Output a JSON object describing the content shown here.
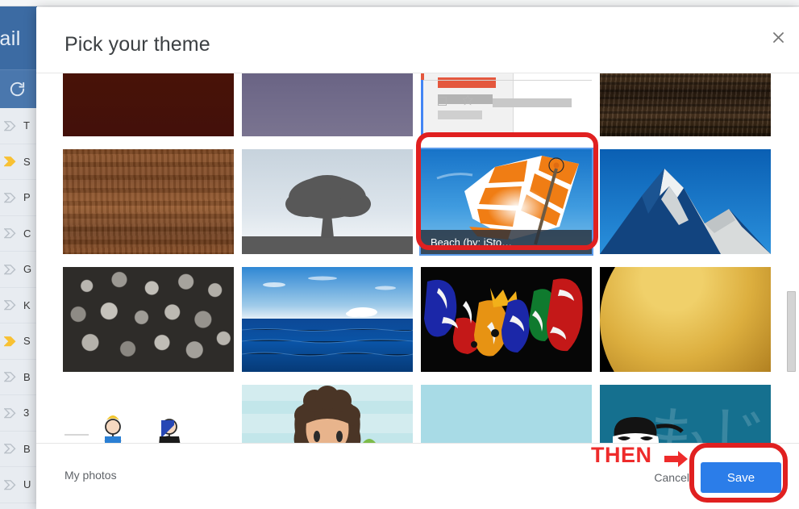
{
  "background_app": {
    "name": "Gmail",
    "logo_text": "mail",
    "refresh_icon": "refresh-icon",
    "mail_rows": [
      {
        "marker": "chevron-outline",
        "subject": "T"
      },
      {
        "marker": "chevron-filled",
        "subject": "S"
      },
      {
        "marker": "chevron-outline",
        "subject": "P"
      },
      {
        "marker": "chevron-outline",
        "subject": "C"
      },
      {
        "marker": "chevron-outline",
        "subject": "G"
      },
      {
        "marker": "chevron-outline",
        "subject": "K"
      },
      {
        "marker": "chevron-filled",
        "subject": "S"
      },
      {
        "marker": "chevron-outline",
        "subject": "B"
      },
      {
        "marker": "chevron-outline",
        "subject": "3"
      },
      {
        "marker": "chevron-outline",
        "subject": "B"
      },
      {
        "marker": "chevron-outline",
        "subject": "U"
      }
    ]
  },
  "dialog": {
    "title": "Pick your theme",
    "close_icon": "close-icon",
    "themes": [
      {
        "id": "maroon",
        "art": "art-maroon",
        "name": "Dark maroon",
        "caption": "",
        "selected": false
      },
      {
        "id": "purple",
        "art": "art-purple",
        "name": "Purple",
        "caption": "",
        "selected": false
      },
      {
        "id": "default",
        "art": "art-default",
        "name": "Default",
        "caption": "",
        "selected": false
      },
      {
        "id": "darkwood",
        "art": "art-darkwood",
        "name": "Dark wood",
        "caption": "",
        "selected": false
      },
      {
        "id": "wood",
        "art": "art-wood",
        "name": "Wood",
        "caption": "",
        "selected": false
      },
      {
        "id": "tree",
        "art": "art-tree",
        "name": "Tree",
        "caption": "",
        "selected": false
      },
      {
        "id": "beach",
        "art": "art-beach",
        "name": "Beach",
        "caption": "Beach (by: iSto…",
        "selected": true
      },
      {
        "id": "mountain",
        "art": "art-mountain",
        "name": "Mountain",
        "caption": "",
        "selected": false
      },
      {
        "id": "stones",
        "art": "art-stones",
        "name": "Stones",
        "caption": "",
        "selected": false
      },
      {
        "id": "ocean",
        "art": "art-ocean",
        "name": "Ocean",
        "caption": "",
        "selected": false
      },
      {
        "id": "graffiti",
        "art": "art-graffiti",
        "name": "Graffiti",
        "caption": "",
        "selected": false
      },
      {
        "id": "planet",
        "art": "art-planet",
        "name": "Planet",
        "caption": "",
        "selected": false
      },
      {
        "id": "cartoon1",
        "art": "art-cartoon1",
        "name": "Stick figures",
        "caption": "",
        "selected": false
      },
      {
        "id": "cartoon2",
        "art": "art-cartoon2",
        "name": "Girl cartoon",
        "caption": "",
        "selected": false
      },
      {
        "id": "cyan",
        "art": "art-cyan",
        "name": "Light blue",
        "caption": "",
        "selected": false
      },
      {
        "id": "ninja",
        "art": "art-ninja",
        "name": "Ninja",
        "caption": "",
        "selected": false
      }
    ],
    "footer": {
      "my_photos_label": "My photos",
      "cancel_label": "Cancel",
      "save_label": "Save"
    }
  },
  "annotations": {
    "then_label": "THEN",
    "arrow_icon": "arrow-right-icon",
    "ring_color": "#e02020",
    "text_color": "#ee2b2b"
  },
  "colors": {
    "gmail_blue": "#3c6ba3",
    "save_button": "#2b7de9",
    "selection_outline": "#5b9bea",
    "annotation_red": "#e02020"
  },
  "scrollbar": {
    "thumb_label": "vertical-scrollbar-thumb"
  }
}
